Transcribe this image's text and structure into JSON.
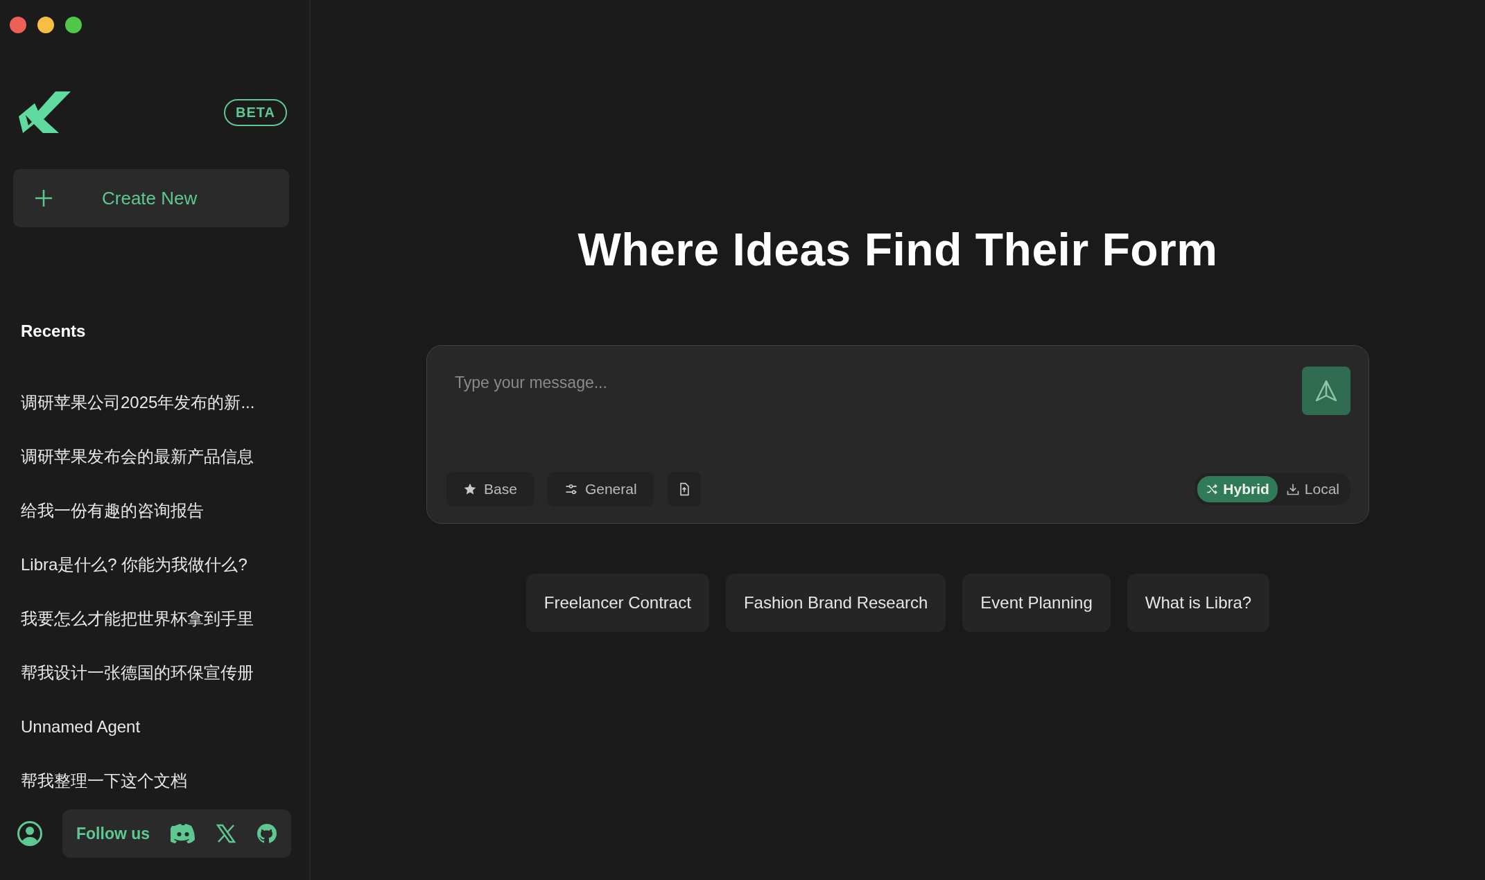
{
  "sidebar": {
    "badge": "BETA",
    "create_button": "Create New",
    "recents_title": "Recents",
    "recents": [
      {
        "label": "调研苹果公司2025年发布的新..."
      },
      {
        "label": "调研苹果发布会的最新产品信息"
      },
      {
        "label": "给我一份有趣的咨询报告"
      },
      {
        "label": "Libra是什么? 你能为我做什么?"
      },
      {
        "label": "我要怎么才能把世界杯拿到手里"
      },
      {
        "label": "帮我设计一张德国的环保宣传册"
      },
      {
        "label": "Unnamed Agent"
      },
      {
        "label": "帮我整理一下这个文档"
      }
    ],
    "follow_label": "Follow us"
  },
  "main": {
    "title": "Where Ideas Find Their Form",
    "composer": {
      "placeholder": "Type your message...",
      "tools": [
        {
          "kind": "star",
          "label": "Base"
        },
        {
          "kind": "sliders",
          "label": "General"
        },
        {
          "kind": "upload"
        }
      ],
      "modes": [
        {
          "kind": "shuffle",
          "label": "Hybrid",
          "selected": true
        },
        {
          "kind": "download",
          "label": "Local",
          "selected": false
        }
      ]
    },
    "suggestions": [
      "Freelancer Contract",
      "Fashion Brand Research",
      "Event Planning",
      "What is Libra?"
    ]
  }
}
